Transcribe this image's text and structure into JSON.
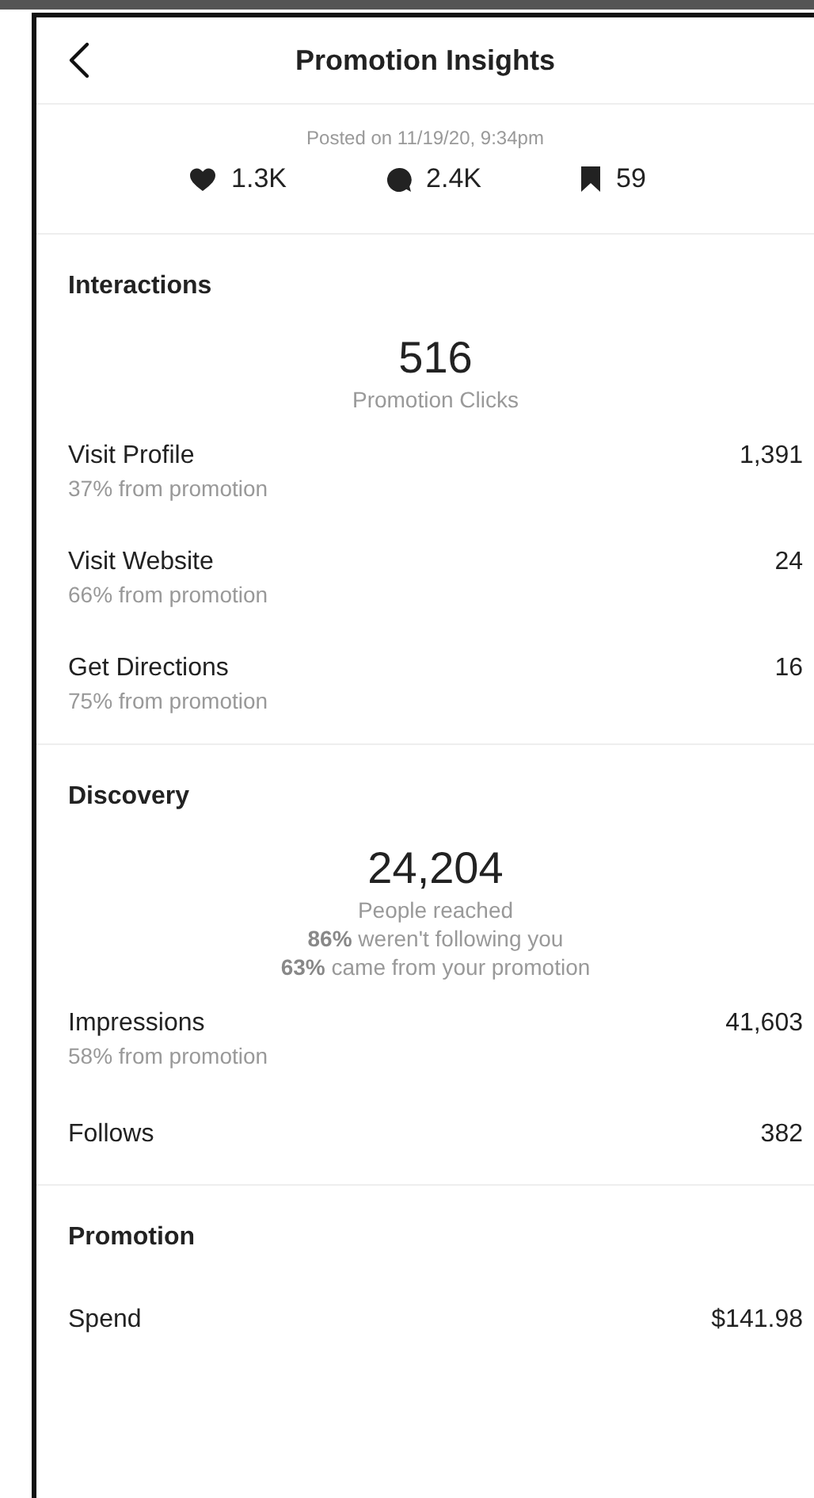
{
  "header": {
    "title": "Promotion Insights"
  },
  "posted": "Posted on 11/19/20, 9:34pm",
  "stats": [
    {
      "kind": "likes",
      "value": "1.3K"
    },
    {
      "kind": "comments",
      "value": "2.4K"
    },
    {
      "kind": "saves",
      "value": "59"
    }
  ],
  "sections": [
    {
      "title": "Interactions",
      "summary": {
        "value": "516",
        "label": "Promotion Clicks"
      },
      "rows": [
        {
          "label": "Visit Profile",
          "sub": "37% from promotion",
          "value": "1,391"
        },
        {
          "label": "Visit Website",
          "sub": "66% from promotion",
          "value": "24"
        },
        {
          "label": "Get Directions",
          "sub": "75% from promotion",
          "value": "16"
        }
      ]
    },
    {
      "title": "Discovery",
      "summary": {
        "value": "24,204",
        "label": "People reached",
        "notes": [
          "**86%** weren't following you",
          "**63%** came from your promotion"
        ]
      },
      "rows": [
        {
          "label": "Impressions",
          "sub": "58% from promotion",
          "value": "41,603"
        },
        {
          "label": "Follows",
          "value": "382"
        }
      ]
    },
    {
      "title": "Promotion",
      "rows": [
        {
          "label": "Spend",
          "value": "$141.98"
        }
      ]
    }
  ]
}
